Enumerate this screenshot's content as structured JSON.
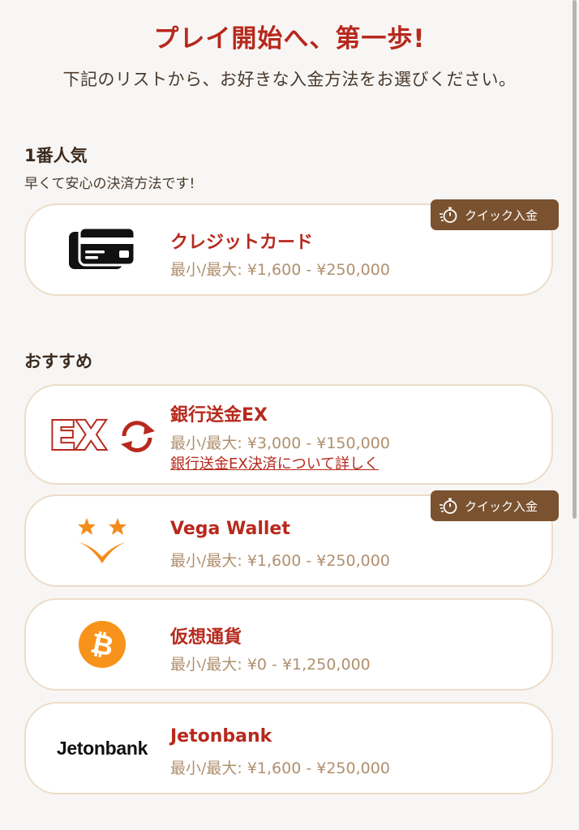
{
  "header": {
    "title": "プレイ開始へ、第一歩!",
    "subtitle": "下記のリストから、お好きな入金方法をお選びください。"
  },
  "sections": {
    "popular": {
      "title": "1番人気",
      "subtitle": "早くて安心の決済方法です!"
    },
    "recommended": {
      "title": "おすすめ"
    }
  },
  "badge_label": "クイック入金",
  "methods": [
    {
      "name": "クレジットカード",
      "range": "最小/最大: ¥1,600 - ¥250,000",
      "icon": "credit-card-icon",
      "quick": true
    },
    {
      "name": "銀行送金EX",
      "range": "最小/最大: ¥3,000 - ¥150,000",
      "link": "銀行送金EX決済について詳しく",
      "icon": "ex-logo",
      "logo_text": "EX"
    },
    {
      "name": "Vega Wallet",
      "range": "最小/最大: ¥1,600 - ¥250,000",
      "icon": "vega-wallet-logo",
      "quick": true
    },
    {
      "name": "仮想通貨",
      "range": "最小/最大: ¥0 - ¥1,250,000",
      "icon": "bitcoin-icon"
    },
    {
      "name": "Jetonbank",
      "range": "最小/最大: ¥1,600 - ¥250,000",
      "icon": "jetonbank-logo",
      "logo_text": "Jetonbank"
    }
  ],
  "colors": {
    "accent": "#b7291d",
    "badge_bg": "#7a5230",
    "card_border": "#ecdcc8",
    "range_text": "#b0906e",
    "bitcoin": "#f7931a",
    "vega": "#f28c1c"
  }
}
